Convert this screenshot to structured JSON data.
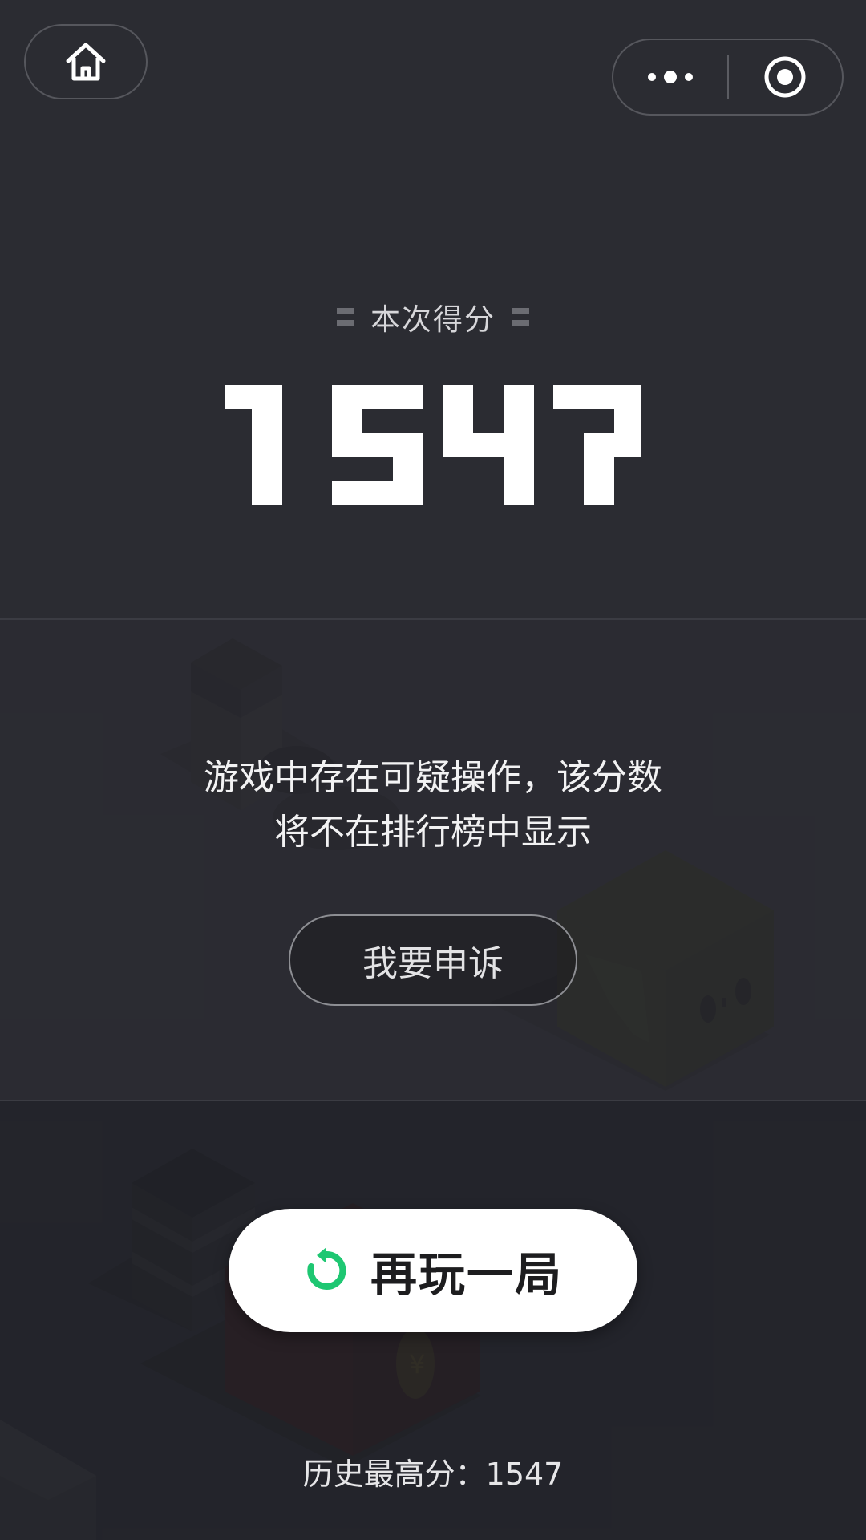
{
  "score_label": "本次得分",
  "score_value": "1547",
  "warning": {
    "line1": "游戏中存在可疑操作，该分数",
    "line2": "将不在排行榜中显示"
  },
  "appeal_button": "我要申诉",
  "replay_button": "再玩一局",
  "best_score": "历史最高分：1547",
  "colors": {
    "background": "#2b2c32",
    "accent_green": "#1ec772",
    "button_white": "#ffffff"
  },
  "icons": {
    "home": "home-icon",
    "more": "more-dots-icon",
    "close": "target-close-icon",
    "replay": "refresh-icon"
  }
}
